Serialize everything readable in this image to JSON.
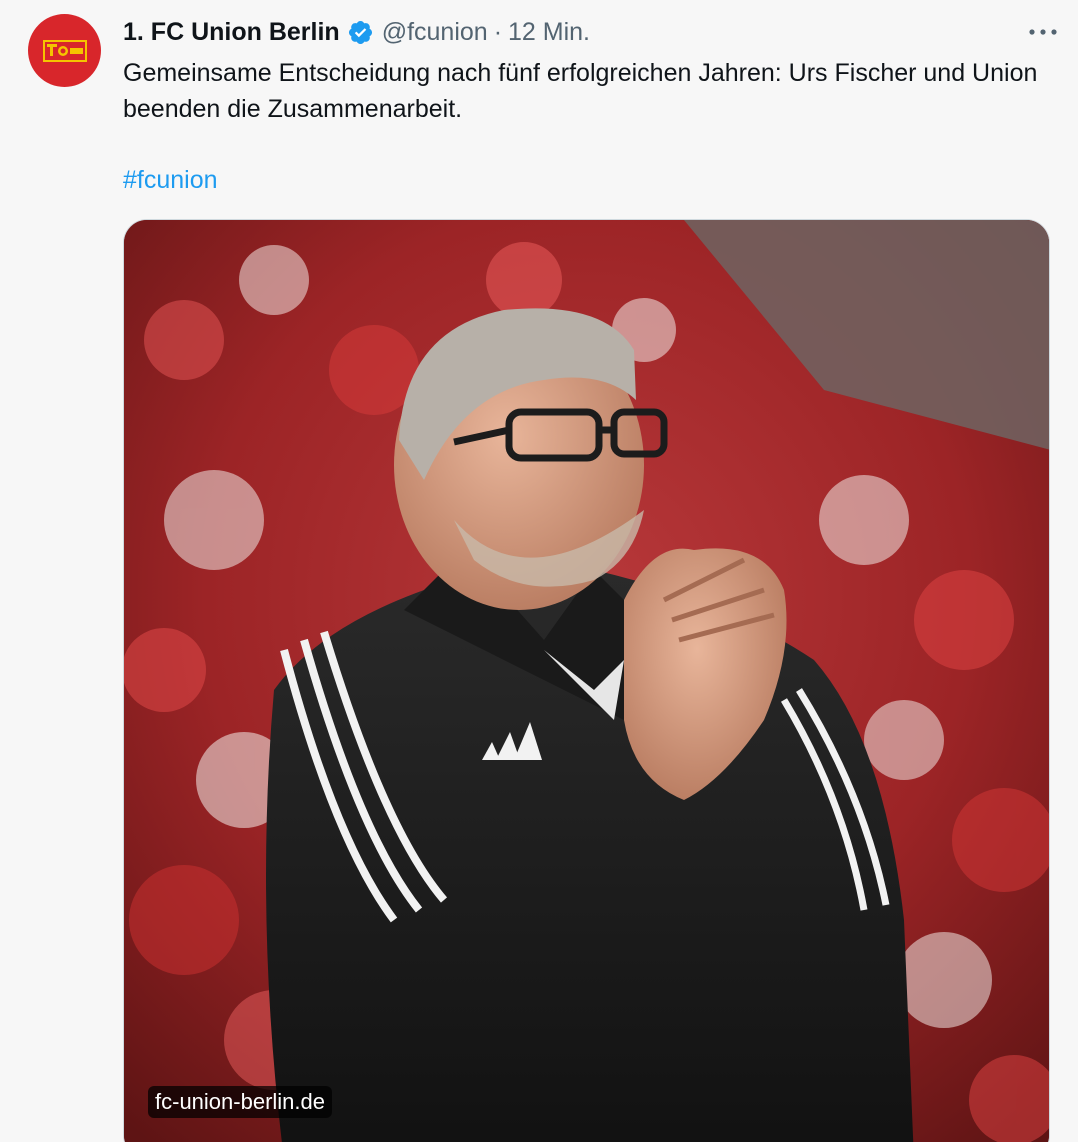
{
  "author": {
    "display_name": "1. FC Union Berlin",
    "handle": "@fcunion",
    "separator": "·",
    "time": "12 Min.",
    "verified": true,
    "avatar_icon": "fc-union-logo-icon"
  },
  "tweet": {
    "text": "Gemeinsame Entscheidung nach fünf erfolgreichen Jahren: Urs Fischer und Union beenden die Zusammenarbeit.",
    "hashtag": "#fcunion"
  },
  "media": {
    "source_label": "fc-union-berlin.de"
  },
  "icons": {
    "verified": "verified-badge-icon",
    "more": "more-options-icon"
  },
  "colors": {
    "link": "#1d9bf0",
    "secondary_text": "#536471",
    "verified": "#1d9bf0",
    "avatar_bg": "#d8262b"
  }
}
